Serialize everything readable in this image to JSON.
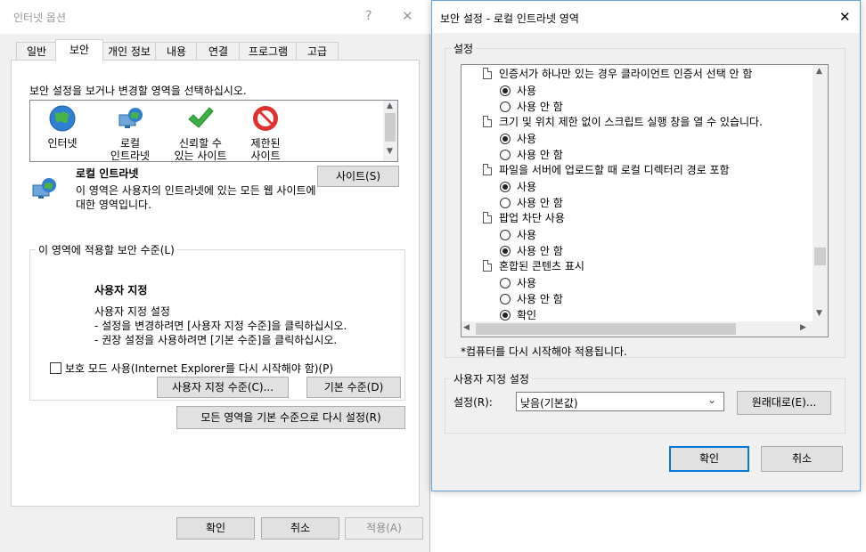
{
  "left": {
    "title": "인터넷 옵션",
    "help_glyph": "?",
    "close_glyph": "✕",
    "tabs": [
      {
        "label": "일반"
      },
      {
        "label": "보안"
      },
      {
        "label": "개인 정보"
      },
      {
        "label": "내용"
      },
      {
        "label": "연결"
      },
      {
        "label": "프로그램"
      },
      {
        "label": "고급"
      }
    ],
    "zone_prompt": "보안 설정을 보거나 변경할 영역을 선택하십시오.",
    "zones": [
      {
        "label": "인터넷",
        "icon": "globe-icon"
      },
      {
        "label": "로컬\n인트라넷",
        "icon": "intranet-icon"
      },
      {
        "label": "신뢰할 수\n있는 사이트",
        "icon": "checkmark-icon"
      },
      {
        "label": "제한된\n사이트",
        "icon": "no-entry-icon"
      }
    ],
    "selected_zone_title": "로컬 인트라넷",
    "selected_zone_desc": "이 영역은 사용자의 인트라넷에 있는 모든 웹 사이트에 대한 영역입니다.",
    "sites_button": "사이트(S)",
    "security_level_group": "이 영역에 적용할 보안 수준(L)",
    "custom_title": "사용자 지정",
    "custom_lines": [
      "사용자 지정 설정",
      "- 설정을 변경하려면 [사용자 지정 수준]을 클릭하십시오.",
      "- 권장 설정을 사용하려면 [기본 수준]을 클릭하십시오."
    ],
    "protected_mode_label": "보호 모드 사용(Internet Explorer를 다시 시작해야 함)(P)",
    "custom_level_button": "사용자 지정 수준(C)...",
    "default_level_button": "기본 수준(D)",
    "reset_all_button": "모든 영역을 기본 수준으로 다시 설정(R)",
    "ok_button": "확인",
    "cancel_button": "취소",
    "apply_button": "적용(A)"
  },
  "right": {
    "title": "보안 설정 - 로컬 인트라넷 영역",
    "close_glyph": "✕",
    "settings_group": "설정",
    "items": [
      {
        "label": "인증서가 하나만 있는 경우 클라이언트 인증서 선택 안 함",
        "options": [
          {
            "label": "사용",
            "selected": true
          },
          {
            "label": "사용 안 함",
            "selected": false
          }
        ]
      },
      {
        "label": "크기 및 위치 제한 없이 스크립트 실행 창을 열 수 있습니다.",
        "options": [
          {
            "label": "사용",
            "selected": true
          },
          {
            "label": "사용 안 함",
            "selected": false
          }
        ]
      },
      {
        "label": "파일을 서버에 업로드할 때 로컬 디렉터리 경로 포함",
        "options": [
          {
            "label": "사용",
            "selected": true
          },
          {
            "label": "사용 안 함",
            "selected": false
          }
        ]
      },
      {
        "label": "팝업 차단 사용",
        "options": [
          {
            "label": "사용",
            "selected": false
          },
          {
            "label": "사용 안 함",
            "selected": true
          }
        ]
      },
      {
        "label": "혼합된 콘텐츠 표시",
        "options": [
          {
            "label": "사용",
            "selected": false
          },
          {
            "label": "사용 안 함",
            "selected": false
          },
          {
            "label": "확인",
            "selected": true
          }
        ]
      }
    ],
    "restart_note": "*컴퓨터를 다시 시작해야 적용됩니다.",
    "custom_group": "사용자 지정 설정",
    "reset_label": "설정(R):",
    "reset_value": "낮음(기본값)",
    "restore_button": "원래대로(E)...",
    "ok_button": "확인",
    "cancel_button": "취소"
  },
  "colors": {
    "accent": "#0078d7",
    "button_face": "#e1e1e1",
    "dialog_bg": "#f0f0f0",
    "border": "#adadad"
  }
}
